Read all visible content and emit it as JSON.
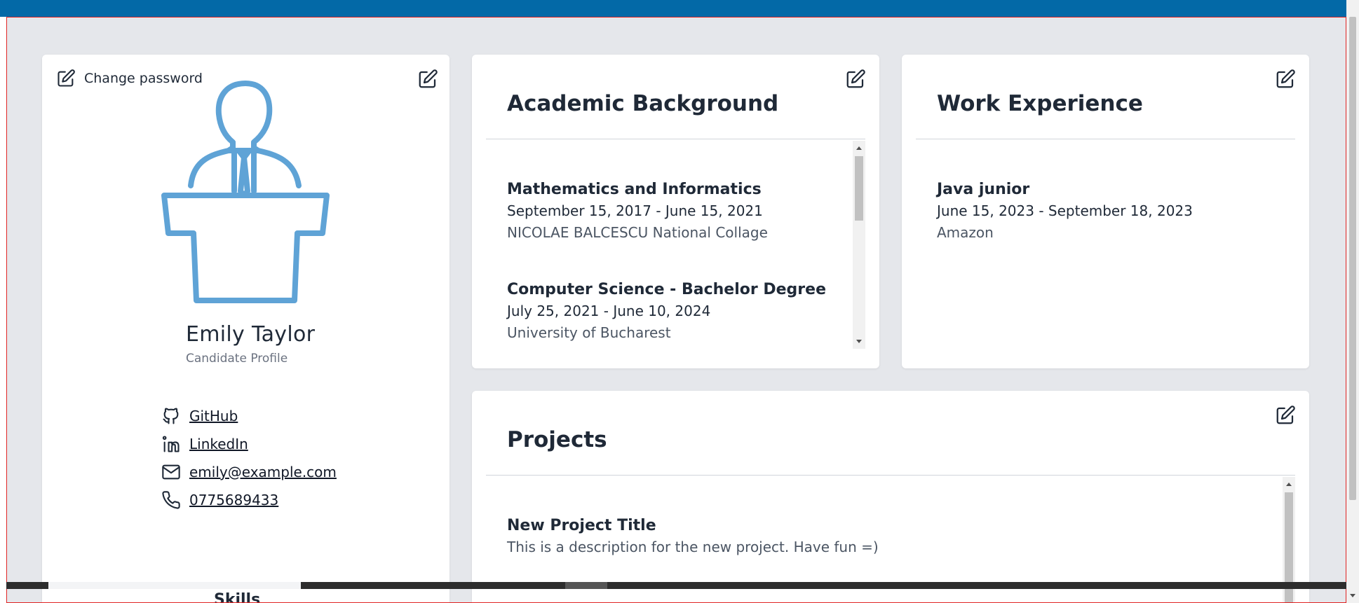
{
  "colors": {
    "topbar": "#0369a7",
    "canvas_bg": "#e5e7eb",
    "avatar_stroke": "#5fa3d6",
    "text_primary": "#1f2937",
    "text_muted": "#6b7280"
  },
  "icons": {
    "edit": "pencil-square-icon",
    "avatar": "speaker-at-podium-icon",
    "github": "github-icon",
    "linkedin": "linkedin-icon",
    "email": "envelope-icon",
    "phone": "phone-icon"
  },
  "profile": {
    "change_password_label": "Change password",
    "name": "Emily Taylor",
    "subtitle": "Candidate Profile",
    "contacts": [
      {
        "label": "GitHub",
        "icon": "github-icon"
      },
      {
        "label": "LinkedIn",
        "icon": "linkedin-icon"
      },
      {
        "label": "emily@example.com",
        "icon": "envelope-icon"
      },
      {
        "label": "0775689433",
        "icon": "phone-icon"
      }
    ],
    "skills_title": "Skills"
  },
  "academic": {
    "title": "Academic Background",
    "entries": [
      {
        "title": "Mathematics and Informatics",
        "dates": "September 15, 2017 - June 15, 2021",
        "org": "NICOLAE BALCESCU National Collage"
      },
      {
        "title": "Computer Science - Bachelor Degree",
        "dates": "July 25, 2021 - June 10, 2024",
        "org": "University of Bucharest"
      }
    ]
  },
  "work": {
    "title": "Work Experience",
    "entries": [
      {
        "title": "Java junior",
        "dates": "June 15, 2023 - September 18, 2023",
        "org": "Amazon"
      }
    ]
  },
  "projects": {
    "title": "Projects",
    "entries": [
      {
        "title": "New Project Title",
        "description": "This is a description for the new project. Have fun =)"
      }
    ]
  }
}
